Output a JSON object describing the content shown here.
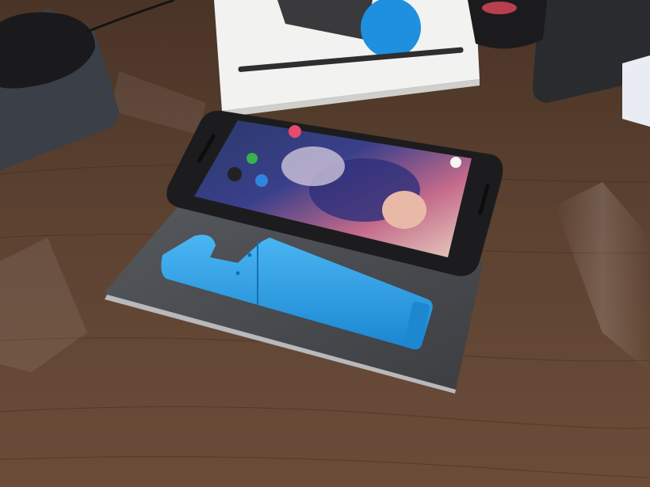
{
  "scene": {
    "description_elements": [
      "desk",
      "mouse",
      "mousepad",
      "product-box",
      "phone",
      "folio-case",
      "phone-stand",
      "dark-device"
    ],
    "colors": {
      "desk": "#5a3f2e",
      "desk_highlight": "#8a6a55",
      "stand": "#2e9fe6",
      "phone_body": "#1c1c1e",
      "case": "#4a4c50",
      "box": "#f2f2f0",
      "badge": "#1f8fe0"
    }
  },
  "box": {
    "text_lines": [
      "",
      ""
    ]
  }
}
